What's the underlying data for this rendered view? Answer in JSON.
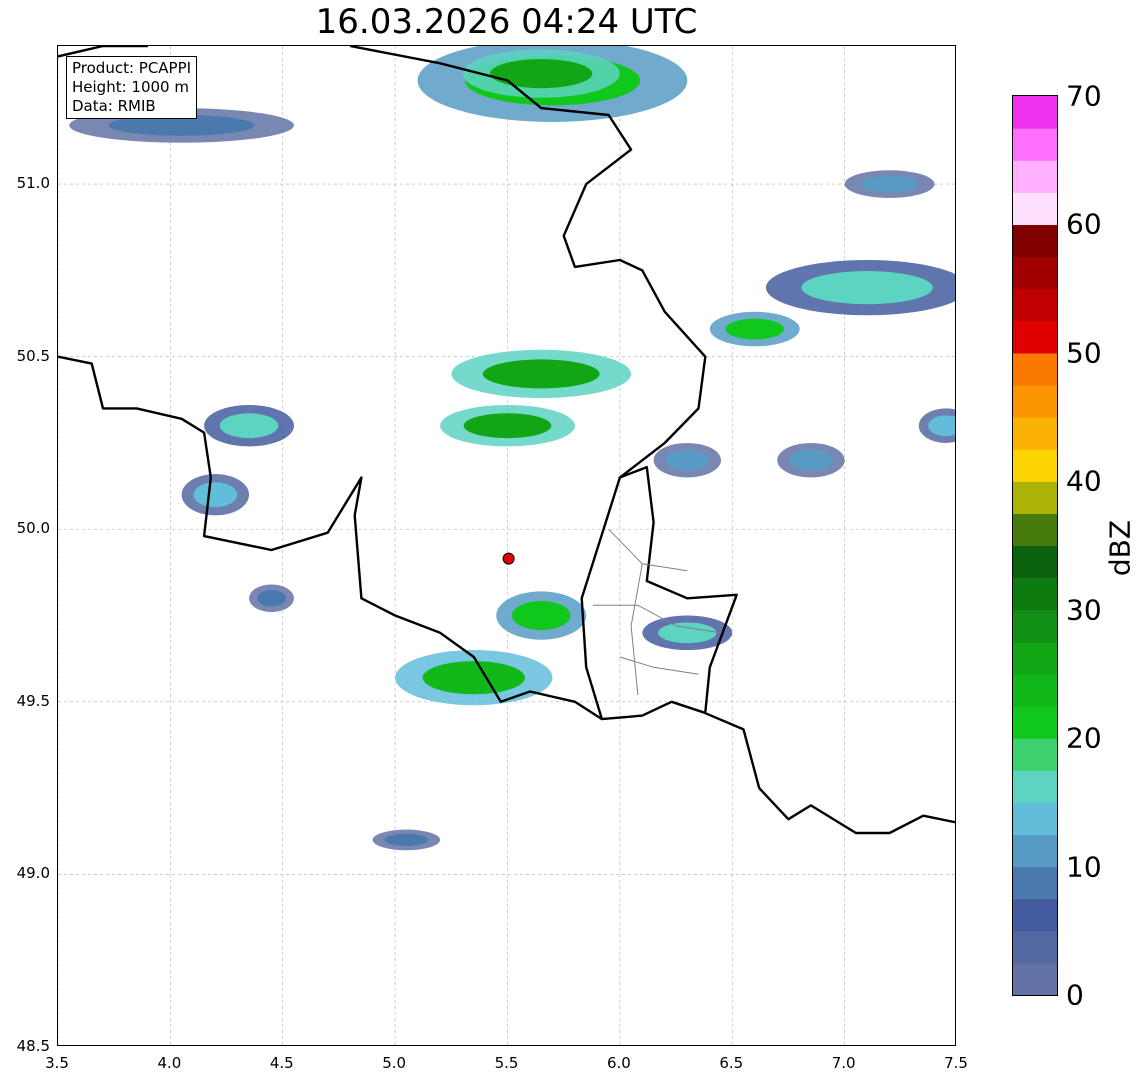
{
  "title": "16.03.2026 04:24 UTC",
  "info": {
    "product": "Product: PCAPPI",
    "height": "Height: 1000 m",
    "source": "Data: RMIB"
  },
  "axes": {
    "x_ticks": [
      "3.5",
      "4.0",
      "4.5",
      "5.0",
      "5.5",
      "6.0",
      "6.5",
      "7.0",
      "7.5"
    ],
    "y_ticks": [
      "48.5",
      "49.0",
      "49.5",
      "50.0",
      "50.5",
      "51.0"
    ],
    "xlim": [
      3.5,
      7.5
    ],
    "ylim": [
      48.5,
      51.4
    ]
  },
  "colorbar": {
    "label": "dBZ",
    "ticks": [
      "0",
      "10",
      "20",
      "30",
      "40",
      "50",
      "60",
      "70"
    ],
    "range": [
      0,
      70
    ],
    "colors": [
      "#6272a6",
      "#5468a1",
      "#445c9f",
      "#4a79ae",
      "#579bc4",
      "#62bdda",
      "#5dd3c2",
      "#3dd26d",
      "#10c71c",
      "#12b719",
      "#12a616",
      "#118f14",
      "#0d7b10",
      "#0b620c",
      "#467a0b",
      "#adb206",
      "#fed502",
      "#fcb204",
      "#fc9600",
      "#fc7900",
      "#e00000",
      "#c00000",
      "#a00000",
      "#800000",
      "#ffe0ff",
      "#ffb0ff",
      "#ff70ff",
      "#ee33ee"
    ]
  },
  "radar_site": {
    "lon": 5.505,
    "lat": 49.915,
    "color": "#e00000"
  },
  "map": {
    "grid_color": "#b0b0b0",
    "border_color": "#000000",
    "admin_color": "#808080"
  },
  "echoes": [
    {
      "lon": 5.7,
      "lat": 51.3,
      "rx": 0.6,
      "ry": 0.12,
      "dbz": 20
    },
    {
      "lon": 5.65,
      "lat": 51.32,
      "rx": 0.35,
      "ry": 0.07,
      "dbz": 27
    },
    {
      "lon": 4.05,
      "lat": 51.17,
      "rx": 0.5,
      "ry": 0.05,
      "dbz": 8
    },
    {
      "lon": 7.1,
      "lat": 50.7,
      "rx": 0.45,
      "ry": 0.08,
      "dbz": 17
    },
    {
      "lon": 6.6,
      "lat": 50.58,
      "rx": 0.2,
      "ry": 0.05,
      "dbz": 22
    },
    {
      "lon": 7.2,
      "lat": 51.0,
      "rx": 0.2,
      "ry": 0.04,
      "dbz": 12
    },
    {
      "lon": 5.65,
      "lat": 50.45,
      "rx": 0.4,
      "ry": 0.07,
      "dbz": 25
    },
    {
      "lon": 5.5,
      "lat": 50.3,
      "rx": 0.3,
      "ry": 0.06,
      "dbz": 27
    },
    {
      "lon": 6.3,
      "lat": 50.2,
      "rx": 0.15,
      "ry": 0.05,
      "dbz": 12
    },
    {
      "lon": 4.35,
      "lat": 50.3,
      "rx": 0.2,
      "ry": 0.06,
      "dbz": 15
    },
    {
      "lon": 4.2,
      "lat": 50.1,
      "rx": 0.15,
      "ry": 0.06,
      "dbz": 14
    },
    {
      "lon": 5.65,
      "lat": 49.75,
      "rx": 0.2,
      "ry": 0.07,
      "dbz": 22
    },
    {
      "lon": 5.35,
      "lat": 49.57,
      "rx": 0.35,
      "ry": 0.08,
      "dbz": 24
    },
    {
      "lon": 6.3,
      "lat": 49.7,
      "rx": 0.2,
      "ry": 0.05,
      "dbz": 17
    },
    {
      "lon": 7.45,
      "lat": 50.3,
      "rx": 0.12,
      "ry": 0.05,
      "dbz": 14
    },
    {
      "lon": 6.85,
      "lat": 50.2,
      "rx": 0.15,
      "ry": 0.05,
      "dbz": 11
    },
    {
      "lon": 5.05,
      "lat": 49.1,
      "rx": 0.15,
      "ry": 0.03,
      "dbz": 8
    },
    {
      "lon": 4.45,
      "lat": 49.8,
      "rx": 0.1,
      "ry": 0.04,
      "dbz": 9
    }
  ]
}
